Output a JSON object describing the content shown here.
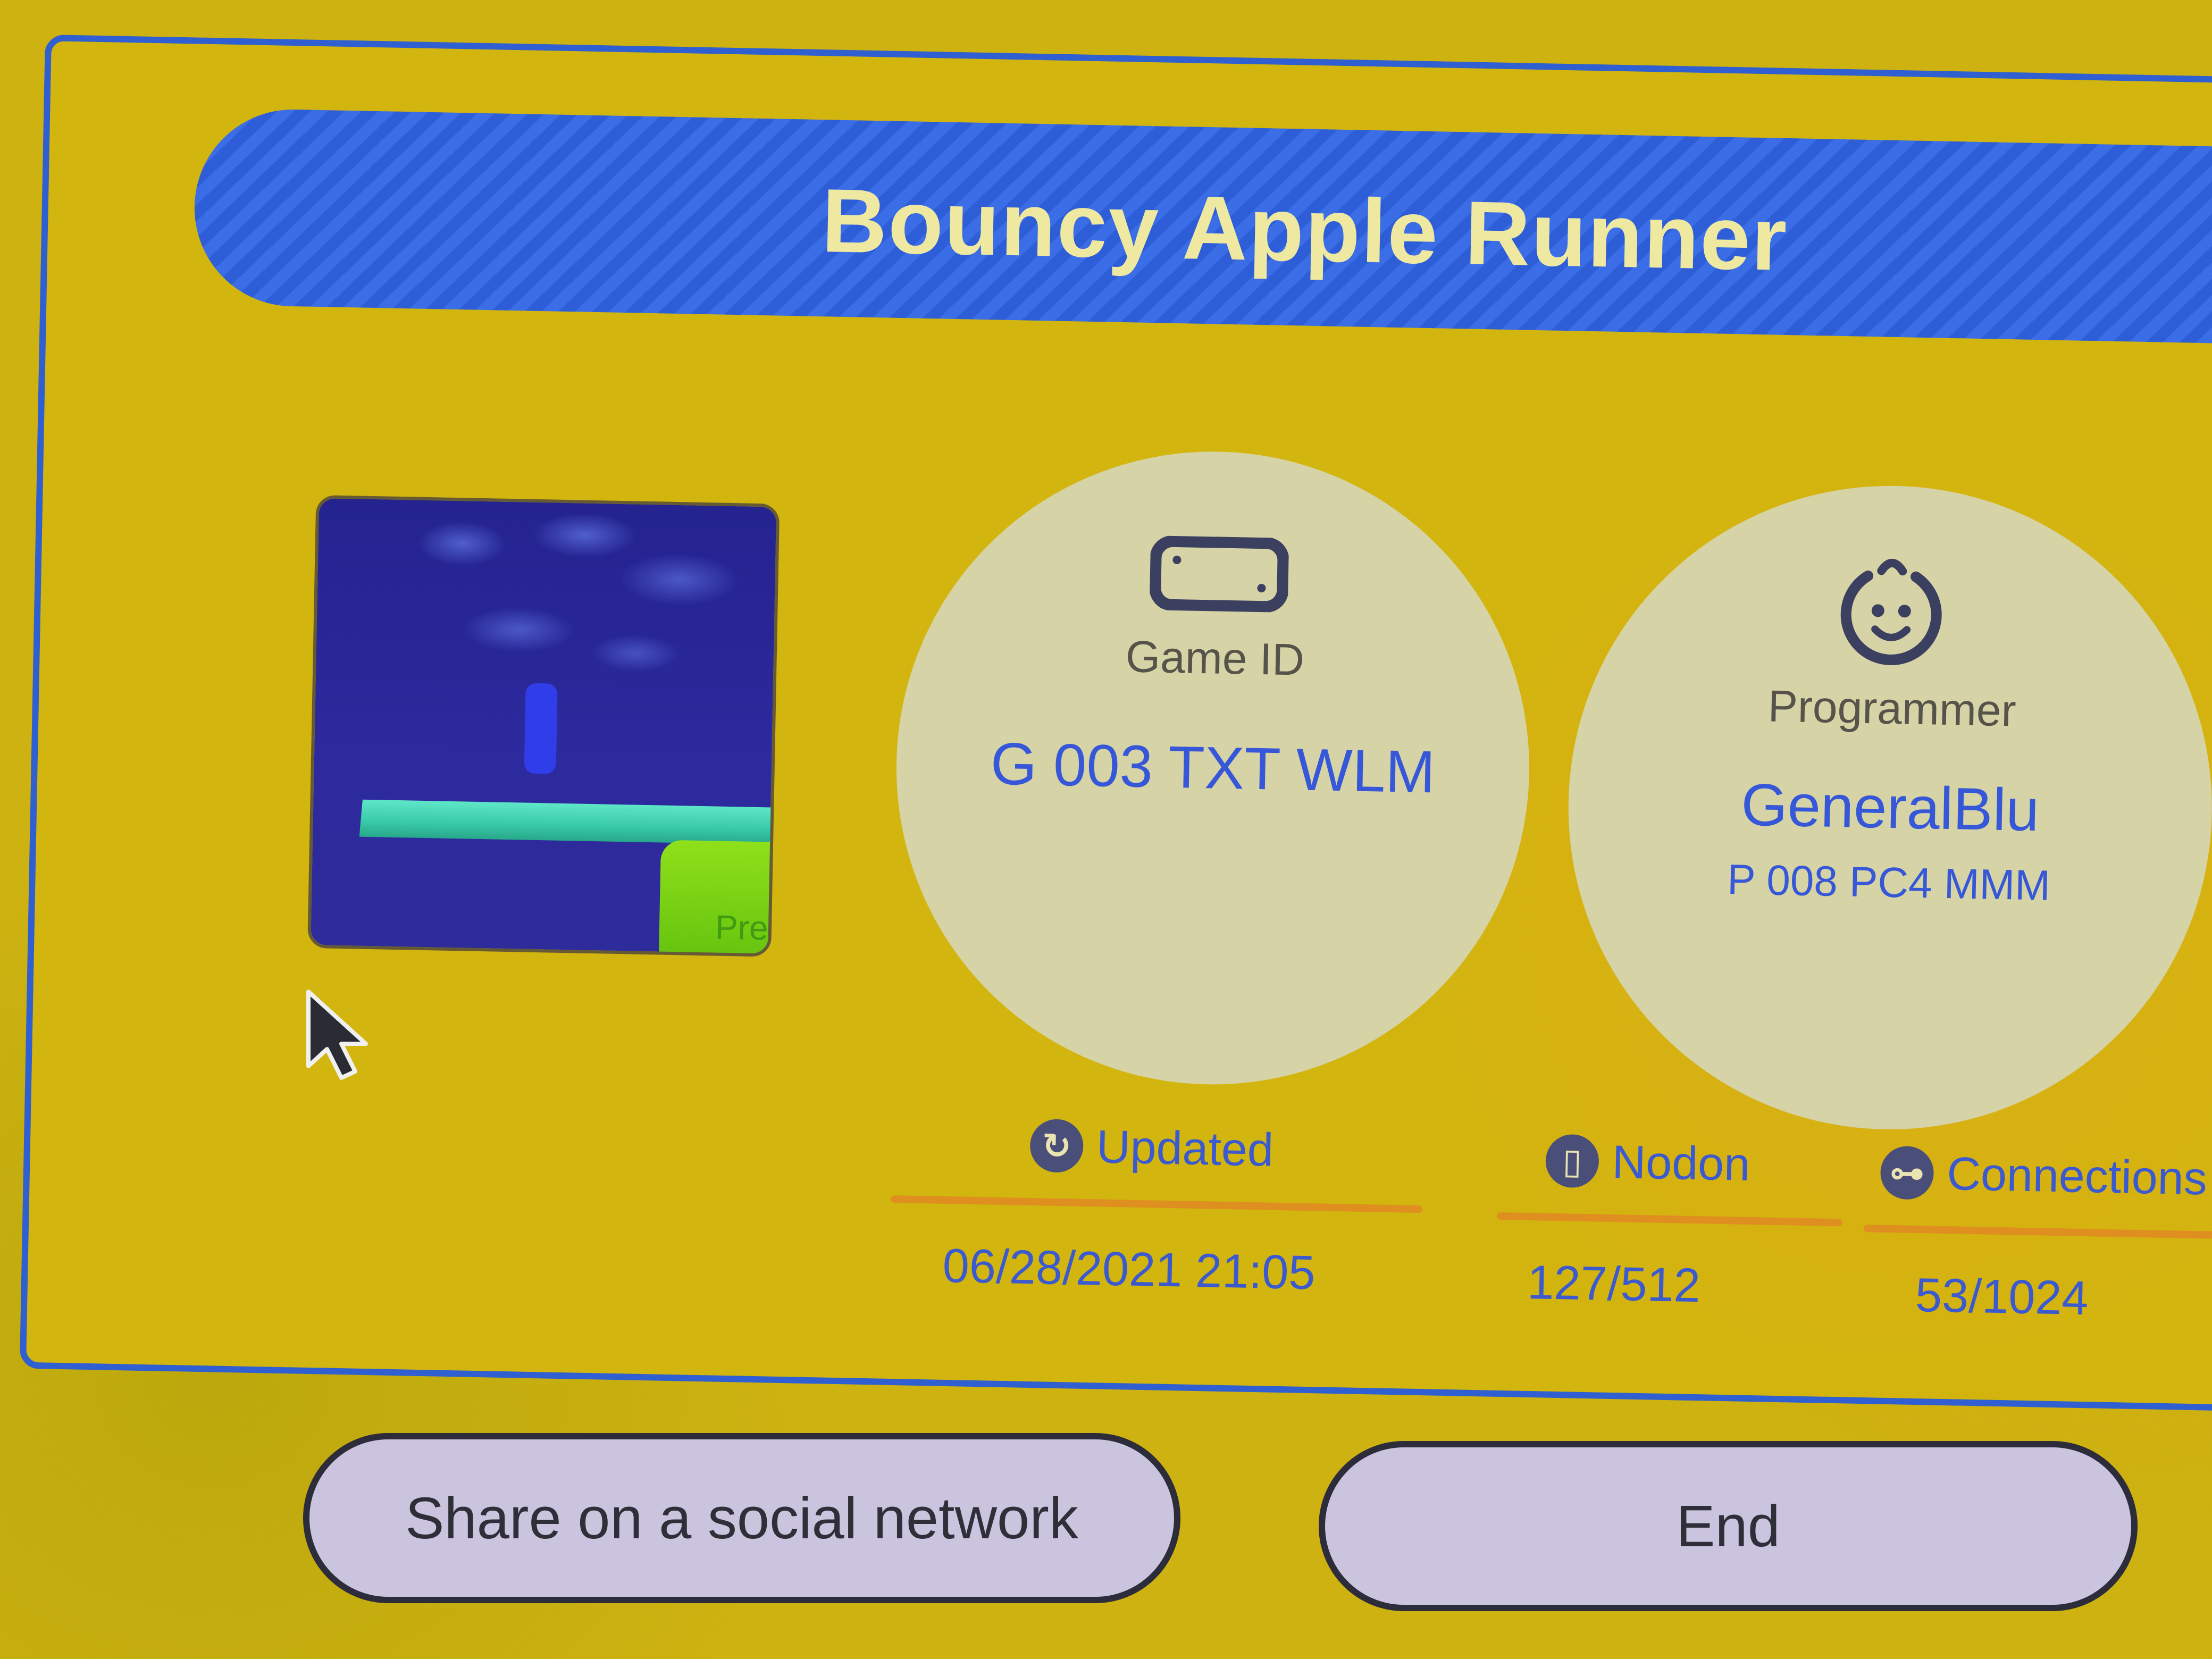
{
  "title": "Bouncy Apple Runner",
  "thumbnail": {
    "label": "Pre"
  },
  "game_id": {
    "label": "Game ID",
    "value": "G 003 TXT WLM",
    "icon": "switch-console-icon"
  },
  "programmer": {
    "label": "Programmer",
    "name": "GeneralBlu",
    "id": "P 008 PC4 MMM",
    "icon": "smiling-face-icon"
  },
  "stats": {
    "updated": {
      "label": "Updated",
      "value": "06/28/2021 21:05",
      "icon": "refresh-icon"
    },
    "nodon": {
      "label": "Nodon",
      "value": "127/512",
      "icon": "nodon-icon"
    },
    "connections": {
      "label": "Connections",
      "value": "53/1024",
      "icon": "connection-icon"
    }
  },
  "buttons": {
    "share_label": "Share on a social network",
    "end_label": "End"
  },
  "colors": {
    "background": "#cdb211",
    "panel_border": "#2f5fd0",
    "title_bar": "#2d5ed8",
    "title_text": "#efe8a0",
    "circle_fill": "#d6d3a6",
    "value_text": "#3657d8",
    "stat_rule": "#de8f1f",
    "button_fill": "#cbc4df"
  }
}
